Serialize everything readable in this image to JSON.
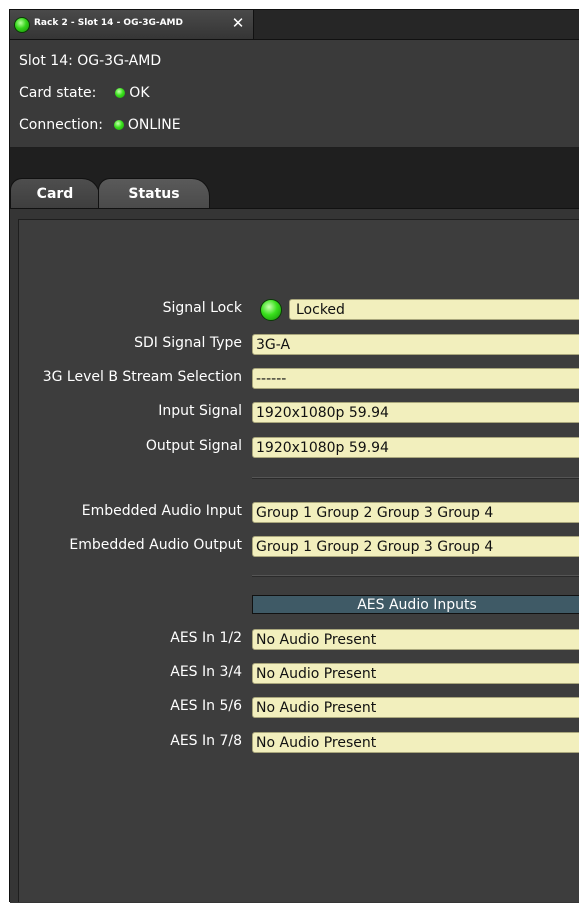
{
  "window": {
    "tab_title": "Rack 2 - Slot 14 - OG-3G-AMD",
    "close_symbol": "✕"
  },
  "info": {
    "slot": "Slot 14: OG-3G-AMD",
    "card_state_label": "Card state:",
    "card_state_value": "OK",
    "connection_label": "Connection:",
    "connection_value": "ONLINE",
    "status_color": "#39e01c"
  },
  "tabs": {
    "card": "Card",
    "status": "Status",
    "selected": "Status"
  },
  "status": {
    "signal_lock_label": "Signal Lock",
    "signal_lock_value": "Locked",
    "sdi_type_label": "SDI Signal Type",
    "sdi_type_value": "3G-A",
    "stream_sel_label": "3G Level B Stream Selection",
    "stream_sel_value": "------",
    "input_signal_label": "Input Signal",
    "input_signal_value": "1920x1080p 59.94",
    "output_signal_label": "Output Signal",
    "output_signal_value": "1920x1080p 59.94",
    "emb_in_label": "Embedded Audio Input",
    "emb_in_value": "Group 1 Group 2 Group 3 Group 4",
    "emb_out_label": "Embedded Audio Output",
    "emb_out_value": "Group 1 Group 2 Group 3 Group 4",
    "aes_header": "AES Audio Inputs",
    "aes": [
      {
        "label": "AES In 1/2",
        "value": "No Audio Present"
      },
      {
        "label": "AES In 3/4",
        "value": "No Audio Present"
      },
      {
        "label": "AES In 5/6",
        "value": "No Audio Present"
      },
      {
        "label": "AES In 7/8",
        "value": "No Audio Present"
      }
    ]
  },
  "colors": {
    "field_bg": "#f2efbd",
    "section_header_bg": "#3f5a66",
    "panel_bg": "#3d3d3d"
  }
}
